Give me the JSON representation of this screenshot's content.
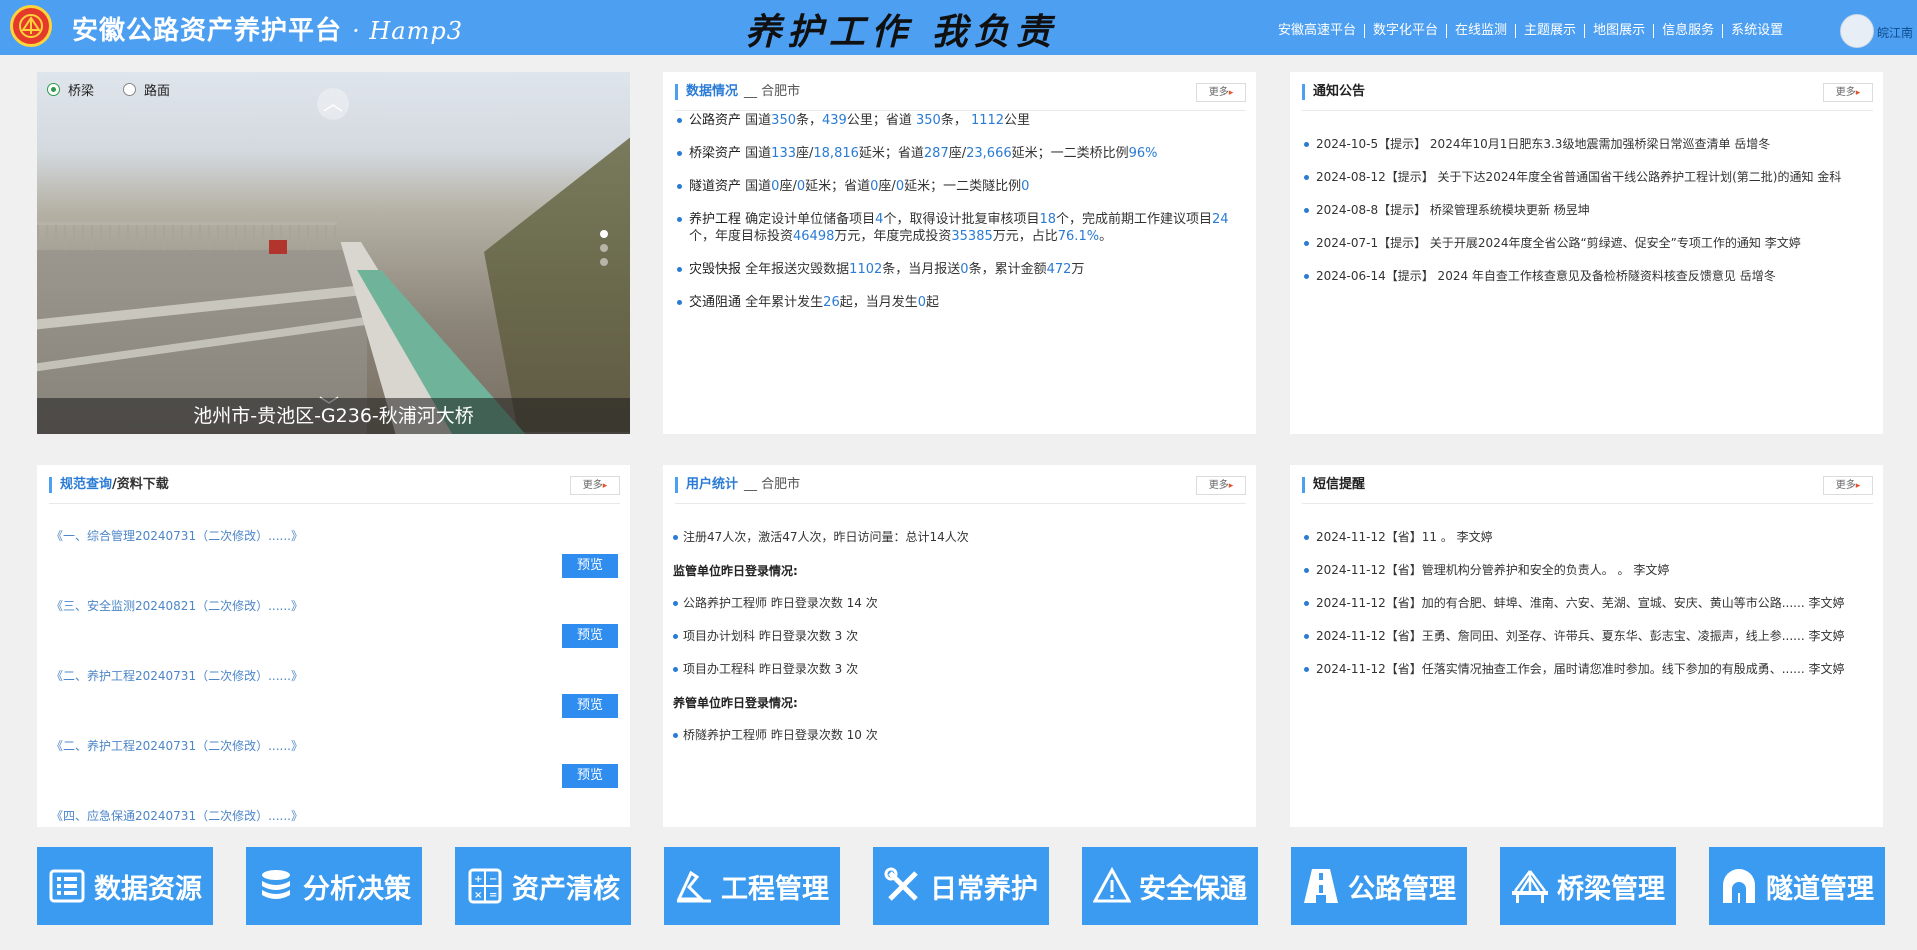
{
  "header": {
    "app_title": "安徽公路资产养护平台",
    "app_subtitle": "· Hamp3",
    "slogan": "养护工作 我负责",
    "nav": [
      "安徽高速平台",
      "数字化平台",
      "在线监测",
      "主题展示",
      "地图展示",
      "信息服务",
      "系统设置"
    ],
    "username": "皖江南"
  },
  "photo": {
    "radio_options": [
      "桥梁",
      "路面"
    ],
    "selected": "桥梁",
    "caption": "池州市-贵池区-G236-秋浦河大桥",
    "slide_count": 3,
    "active_slide": 1
  },
  "data_panel": {
    "title": "数据情况",
    "location": "合肥市",
    "more": "更多",
    "highway": {
      "label": "公路资产",
      "t1": "国道",
      "v1": "350",
      "t2": "条，",
      "v2": "439",
      "t3": "公里；省道 ",
      "v3": "350",
      "t4": "条， ",
      "v4": "1112",
      "t5": "公里"
    },
    "bridge": {
      "label": "桥梁资产",
      "t1": "国道",
      "v1": "133",
      "t2": "座/",
      "v2": "18,816",
      "t3": "延米；省道",
      "v3": "287",
      "t4": "座/",
      "v4": "23,666",
      "t5": "延米；一二类桥比例",
      "v5": "96%"
    },
    "tunnel": {
      "label": "隧道资产",
      "t1": "国道",
      "v1": "0",
      "t2": "座/",
      "v2": "0",
      "t3": "延米；省道",
      "v3": "0",
      "t4": "座/",
      "v4": "0",
      "t5": "延米；一二类隧比例",
      "v5": "0"
    },
    "project": {
      "label": "养护工程",
      "t1": "确定设计单位储备项目",
      "v1": "4",
      "t2": "个，取得设计批复审核项目",
      "v2": "18",
      "t3": "个，完成前期工作建议项目",
      "v3": "24",
      "t4": "个，年度目标投资",
      "v4": "46498",
      "t5": "万元，年度完成投资",
      "v5": "35385",
      "t6": "万元，占比",
      "v6": "76.1%",
      "t7": "。"
    },
    "disaster": {
      "label": "灾毁快报",
      "t1": "全年报送灾毁数据",
      "v1": "1102",
      "t2": "条，当月报送",
      "v2": "0",
      "t3": "条，累计金额",
      "v3": "472",
      "t4": "万"
    },
    "traffic": {
      "label": "交通阻通",
      "t1": "全年累计发生",
      "v1": "26",
      "t2": "起，当月发生",
      "v2": "0",
      "t3": "起"
    }
  },
  "notice_panel": {
    "title": "通知公告",
    "more": "更多",
    "items": [
      "2024-10-5【提示】 2024年10月1日肥东3.3级地震需加强桥梁日常巡查清单 岳增冬",
      "2024-08-12【提示】 关于下达2024年度全省普通国省干线公路养护工程计划(第二批)的通知 金科",
      "2024-08-8【提示】 桥梁管理系统模块更新 杨昱坤",
      "2024-07-1【提示】 关于开展2024年度全省公路“剪绿遮、促安全”专项工作的通知 李文婷",
      "2024-06-14【提示】 2024 年自查工作核查意见及备检桥隧资料核查反馈意见 岳增冬"
    ]
  },
  "docs_panel": {
    "title_hl": "规范查询",
    "title_rest": "/资料下载",
    "more": "更多",
    "preview": "预览",
    "items": [
      "《一、综合管理20240731（二次修改）......》",
      "《三、安全监测20240821（二次修改）......》",
      "《二、养护工程20240731（二次修改）......》",
      "《二、养护工程20240731（二次修改）......》",
      "《四、应急保通20240731（二次修改）......》"
    ]
  },
  "user_panel": {
    "title": "用户统计",
    "location": "合肥市",
    "more": "更多",
    "summary": "注册47人次，激活47人次，昨日访问量：总计14人次",
    "supervise_title": "监管单位昨日登录情况:",
    "supervise": [
      "公路养护工程师 昨日登录次数 14 次",
      "项目办计划科 昨日登录次数 3 次",
      "项目办工程科 昨日登录次数 3 次"
    ],
    "maintain_title": "养管单位昨日登录情况:",
    "maintain": [
      "桥隧养护工程师 昨日登录次数 10 次"
    ]
  },
  "sms_panel": {
    "title": "短信提醒",
    "more": "更多",
    "items": [
      "2024-11-12【省】11 。 李文婷",
      "2024-11-12【省】管理机构分管养护和安全的负责人。 。 李文婷",
      "2024-11-12【省】加的有合肥、蚌埠、淮南、六安、芜湖、宣城、安庆、黄山等市公路...... 李文婷",
      "2024-11-12【省】王勇、詹同田、刘圣存、许带兵、夏东华、彭志宝、凌振声，线上参...... 李文婷",
      "2024-11-12【省】任落实情况抽查工作会，届时请您准时参加。线下参加的有殷成勇、...... 李文婷"
    ]
  },
  "modules": [
    {
      "label": "数据资源",
      "icon": "list-icon"
    },
    {
      "label": "分析决策",
      "icon": "database-icon"
    },
    {
      "label": "资产清核",
      "icon": "calculator-icon"
    },
    {
      "label": "工程管理",
      "icon": "engineering-icon"
    },
    {
      "label": "日常养护",
      "icon": "tools-icon"
    },
    {
      "label": "安全保通",
      "icon": "warning-icon"
    },
    {
      "label": "公路管理",
      "icon": "road-icon"
    },
    {
      "label": "桥梁管理",
      "icon": "bridge-icon"
    },
    {
      "label": "隧道管理",
      "icon": "tunnel-icon"
    }
  ],
  "colors": {
    "header": "#4d9ff2",
    "accent": "#2a7bd5",
    "button": "#3a9bf0",
    "background": "#f0f0f0"
  }
}
